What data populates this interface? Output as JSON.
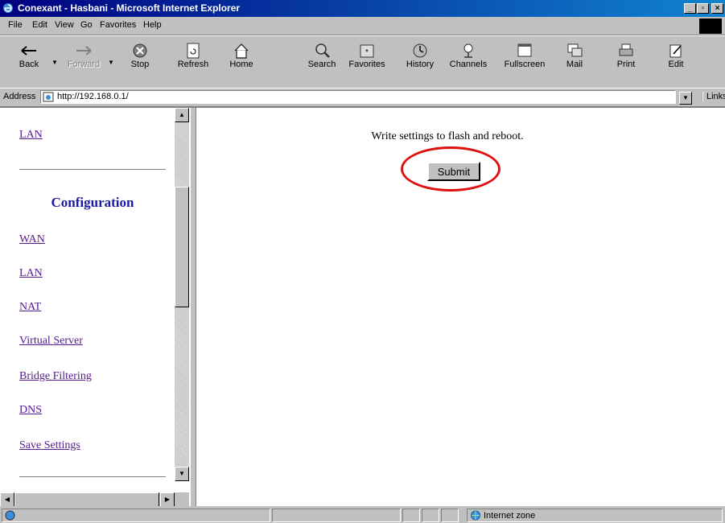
{
  "window": {
    "title": "Conexant - Hasbani - Microsoft Internet Explorer"
  },
  "menu": [
    "File",
    "Edit",
    "View",
    "Go",
    "Favorites",
    "Help"
  ],
  "toolbar": [
    {
      "label": "Back",
      "icon": "back-arrow-icon"
    },
    {
      "label": "Forward",
      "icon": "forward-arrow-icon",
      "disabled": true
    },
    {
      "label": "Stop",
      "icon": "stop-icon"
    },
    {
      "label": "Refresh",
      "icon": "refresh-icon"
    },
    {
      "label": "Home",
      "icon": "home-icon"
    },
    {
      "label": "Search",
      "icon": "search-icon"
    },
    {
      "label": "Favorites",
      "icon": "favorites-icon"
    },
    {
      "label": "History",
      "icon": "history-icon"
    },
    {
      "label": "Channels",
      "icon": "channels-icon"
    },
    {
      "label": "Fullscreen",
      "icon": "fullscreen-icon"
    },
    {
      "label": "Mail",
      "icon": "mail-icon"
    },
    {
      "label": "Print",
      "icon": "print-icon"
    },
    {
      "label": "Edit",
      "icon": "edit-icon"
    }
  ],
  "address": {
    "label": "Address",
    "url": "http://192.168.0.1/",
    "links_label": "Links"
  },
  "sidebar": {
    "top_link": "LAN",
    "heading": "Configuration",
    "items": [
      "WAN",
      "LAN",
      "NAT",
      "Virtual Server",
      "Bridge Filtering",
      "DNS",
      "Save Settings"
    ]
  },
  "main": {
    "message": "Write settings to flash and reboot.",
    "submit_label": "Submit",
    "highlight_color": "#e01010"
  },
  "status": {
    "zone": "Internet zone"
  }
}
